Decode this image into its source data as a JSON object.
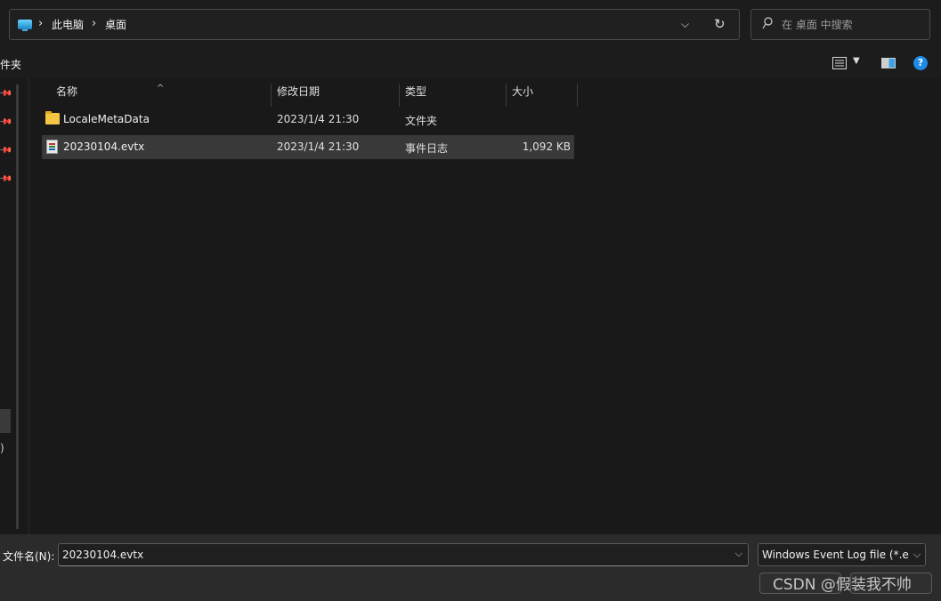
{
  "address": {
    "breadcrumbs": [
      "此电脑",
      "桌面"
    ],
    "separator": "›",
    "dropdown_glyph": "⌵",
    "refresh_glyph": "↻"
  },
  "search": {
    "placeholder": "在 桌面 中搜索"
  },
  "toolbar": {
    "new_folder_label": "件夹",
    "view_dropdown_glyph": "▼",
    "help_glyph": "?"
  },
  "nav": {
    "pin_glyph": "📌",
    "fragment_text": ")"
  },
  "columns": {
    "name": "名称",
    "date": "修改日期",
    "type": "类型",
    "size": "大小",
    "sort_glyph": "^"
  },
  "files": [
    {
      "name": "LocaleMetaData",
      "date": "2023/1/4 21:30",
      "type": "文件夹",
      "size": "",
      "icon": "folder-icon",
      "selected": false
    },
    {
      "name": "20230104.evtx",
      "date": "2023/1/4 21:30",
      "type": "事件日志",
      "size": "1,092 KB",
      "icon": "event-log-icon",
      "selected": true
    }
  ],
  "bottom": {
    "filename_label": "文件名(N):",
    "filename_value": "20230104.evtx",
    "filetype_value": "Windows Event Log file (*.ev",
    "dropdown_glyph": "⌵",
    "watermark": "CSDN @假装我不帅"
  },
  "colors": {
    "background": "#191919",
    "selection": "#393939",
    "accent": "#1e8ae6",
    "folder": "#f6c544"
  }
}
